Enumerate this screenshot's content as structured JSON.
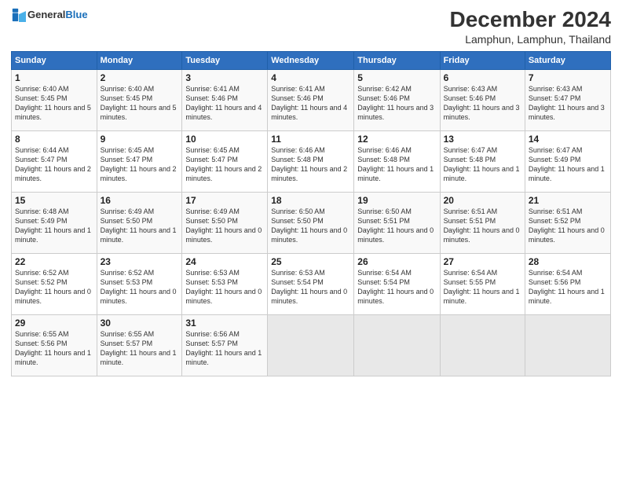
{
  "logo": {
    "general": "General",
    "blue": "Blue"
  },
  "title": "December 2024",
  "subtitle": "Lamphun, Lamphun, Thailand",
  "weekdays": [
    "Sunday",
    "Monday",
    "Tuesday",
    "Wednesday",
    "Thursday",
    "Friday",
    "Saturday"
  ],
  "weeks": [
    [
      {
        "day": "1",
        "sunrise": "6:40 AM",
        "sunset": "5:45 PM",
        "daylight": "11 hours and 5 minutes."
      },
      {
        "day": "2",
        "sunrise": "6:40 AM",
        "sunset": "5:45 PM",
        "daylight": "11 hours and 5 minutes."
      },
      {
        "day": "3",
        "sunrise": "6:41 AM",
        "sunset": "5:46 PM",
        "daylight": "11 hours and 4 minutes."
      },
      {
        "day": "4",
        "sunrise": "6:41 AM",
        "sunset": "5:46 PM",
        "daylight": "11 hours and 4 minutes."
      },
      {
        "day": "5",
        "sunrise": "6:42 AM",
        "sunset": "5:46 PM",
        "daylight": "11 hours and 3 minutes."
      },
      {
        "day": "6",
        "sunrise": "6:43 AM",
        "sunset": "5:46 PM",
        "daylight": "11 hours and 3 minutes."
      },
      {
        "day": "7",
        "sunrise": "6:43 AM",
        "sunset": "5:47 PM",
        "daylight": "11 hours and 3 minutes."
      }
    ],
    [
      {
        "day": "8",
        "sunrise": "6:44 AM",
        "sunset": "5:47 PM",
        "daylight": "11 hours and 2 minutes."
      },
      {
        "day": "9",
        "sunrise": "6:45 AM",
        "sunset": "5:47 PM",
        "daylight": "11 hours and 2 minutes."
      },
      {
        "day": "10",
        "sunrise": "6:45 AM",
        "sunset": "5:47 PM",
        "daylight": "11 hours and 2 minutes."
      },
      {
        "day": "11",
        "sunrise": "6:46 AM",
        "sunset": "5:48 PM",
        "daylight": "11 hours and 2 minutes."
      },
      {
        "day": "12",
        "sunrise": "6:46 AM",
        "sunset": "5:48 PM",
        "daylight": "11 hours and 1 minute."
      },
      {
        "day": "13",
        "sunrise": "6:47 AM",
        "sunset": "5:48 PM",
        "daylight": "11 hours and 1 minute."
      },
      {
        "day": "14",
        "sunrise": "6:47 AM",
        "sunset": "5:49 PM",
        "daylight": "11 hours and 1 minute."
      }
    ],
    [
      {
        "day": "15",
        "sunrise": "6:48 AM",
        "sunset": "5:49 PM",
        "daylight": "11 hours and 1 minute."
      },
      {
        "day": "16",
        "sunrise": "6:49 AM",
        "sunset": "5:50 PM",
        "daylight": "11 hours and 1 minute."
      },
      {
        "day": "17",
        "sunrise": "6:49 AM",
        "sunset": "5:50 PM",
        "daylight": "11 hours and 0 minutes."
      },
      {
        "day": "18",
        "sunrise": "6:50 AM",
        "sunset": "5:50 PM",
        "daylight": "11 hours and 0 minutes."
      },
      {
        "day": "19",
        "sunrise": "6:50 AM",
        "sunset": "5:51 PM",
        "daylight": "11 hours and 0 minutes."
      },
      {
        "day": "20",
        "sunrise": "6:51 AM",
        "sunset": "5:51 PM",
        "daylight": "11 hours and 0 minutes."
      },
      {
        "day": "21",
        "sunrise": "6:51 AM",
        "sunset": "5:52 PM",
        "daylight": "11 hours and 0 minutes."
      }
    ],
    [
      {
        "day": "22",
        "sunrise": "6:52 AM",
        "sunset": "5:52 PM",
        "daylight": "11 hours and 0 minutes."
      },
      {
        "day": "23",
        "sunrise": "6:52 AM",
        "sunset": "5:53 PM",
        "daylight": "11 hours and 0 minutes."
      },
      {
        "day": "24",
        "sunrise": "6:53 AM",
        "sunset": "5:53 PM",
        "daylight": "11 hours and 0 minutes."
      },
      {
        "day": "25",
        "sunrise": "6:53 AM",
        "sunset": "5:54 PM",
        "daylight": "11 hours and 0 minutes."
      },
      {
        "day": "26",
        "sunrise": "6:54 AM",
        "sunset": "5:54 PM",
        "daylight": "11 hours and 0 minutes."
      },
      {
        "day": "27",
        "sunrise": "6:54 AM",
        "sunset": "5:55 PM",
        "daylight": "11 hours and 1 minute."
      },
      {
        "day": "28",
        "sunrise": "6:54 AM",
        "sunset": "5:56 PM",
        "daylight": "11 hours and 1 minute."
      }
    ],
    [
      {
        "day": "29",
        "sunrise": "6:55 AM",
        "sunset": "5:56 PM",
        "daylight": "11 hours and 1 minute."
      },
      {
        "day": "30",
        "sunrise": "6:55 AM",
        "sunset": "5:57 PM",
        "daylight": "11 hours and 1 minute."
      },
      {
        "day": "31",
        "sunrise": "6:56 AM",
        "sunset": "5:57 PM",
        "daylight": "11 hours and 1 minute."
      },
      null,
      null,
      null,
      null
    ]
  ],
  "labels": {
    "sunrise": "Sunrise:",
    "sunset": "Sunset:",
    "daylight": "Daylight:"
  }
}
